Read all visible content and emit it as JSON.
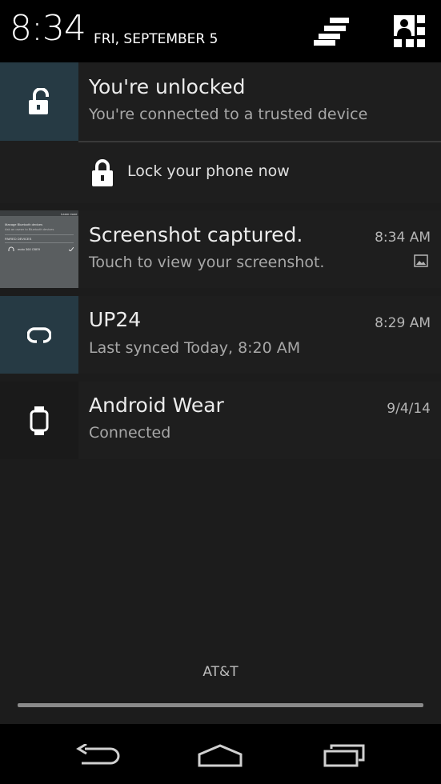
{
  "status": {
    "time": "8:34",
    "date": "FRI, SEPTEMBER 5"
  },
  "header_buttons": [
    {
      "icon": "settings-toggle-icon"
    },
    {
      "icon": "user-switch-icon"
    }
  ],
  "notifications": {
    "trusted": {
      "title": "You're unlocked",
      "subtitle": "You're connected to a trusted device",
      "icon": "unlocked-padlock-icon",
      "icon_bg": "#263a44",
      "action_label": "Lock your phone now"
    },
    "screenshot": {
      "title": "Screenshot captured.",
      "subtitle": "Touch to view your screenshot.",
      "time": "8:34 AM",
      "thumb": {
        "header_text": "Learn more",
        "title_text": "Manage Bluetooth devices",
        "sub_text": "Ask an owner to Bluetooth devices",
        "section_text": "PAIRED DEVICES",
        "device_text": "moto 360 O5E9"
      }
    },
    "up24": {
      "title": "UP24",
      "subtitle": "Last synced Today, 8:20 AM",
      "time": "8:29 AM",
      "icon": "up-band-icon",
      "icon_bg": "#263a44"
    },
    "wear": {
      "title": "Android Wear",
      "subtitle": "Connected",
      "time": "9/4/14",
      "icon": "watch-icon"
    }
  },
  "carrier": "AT&T",
  "nav": {
    "back": "back-icon",
    "home": "home-icon",
    "recents": "recents-icon"
  }
}
